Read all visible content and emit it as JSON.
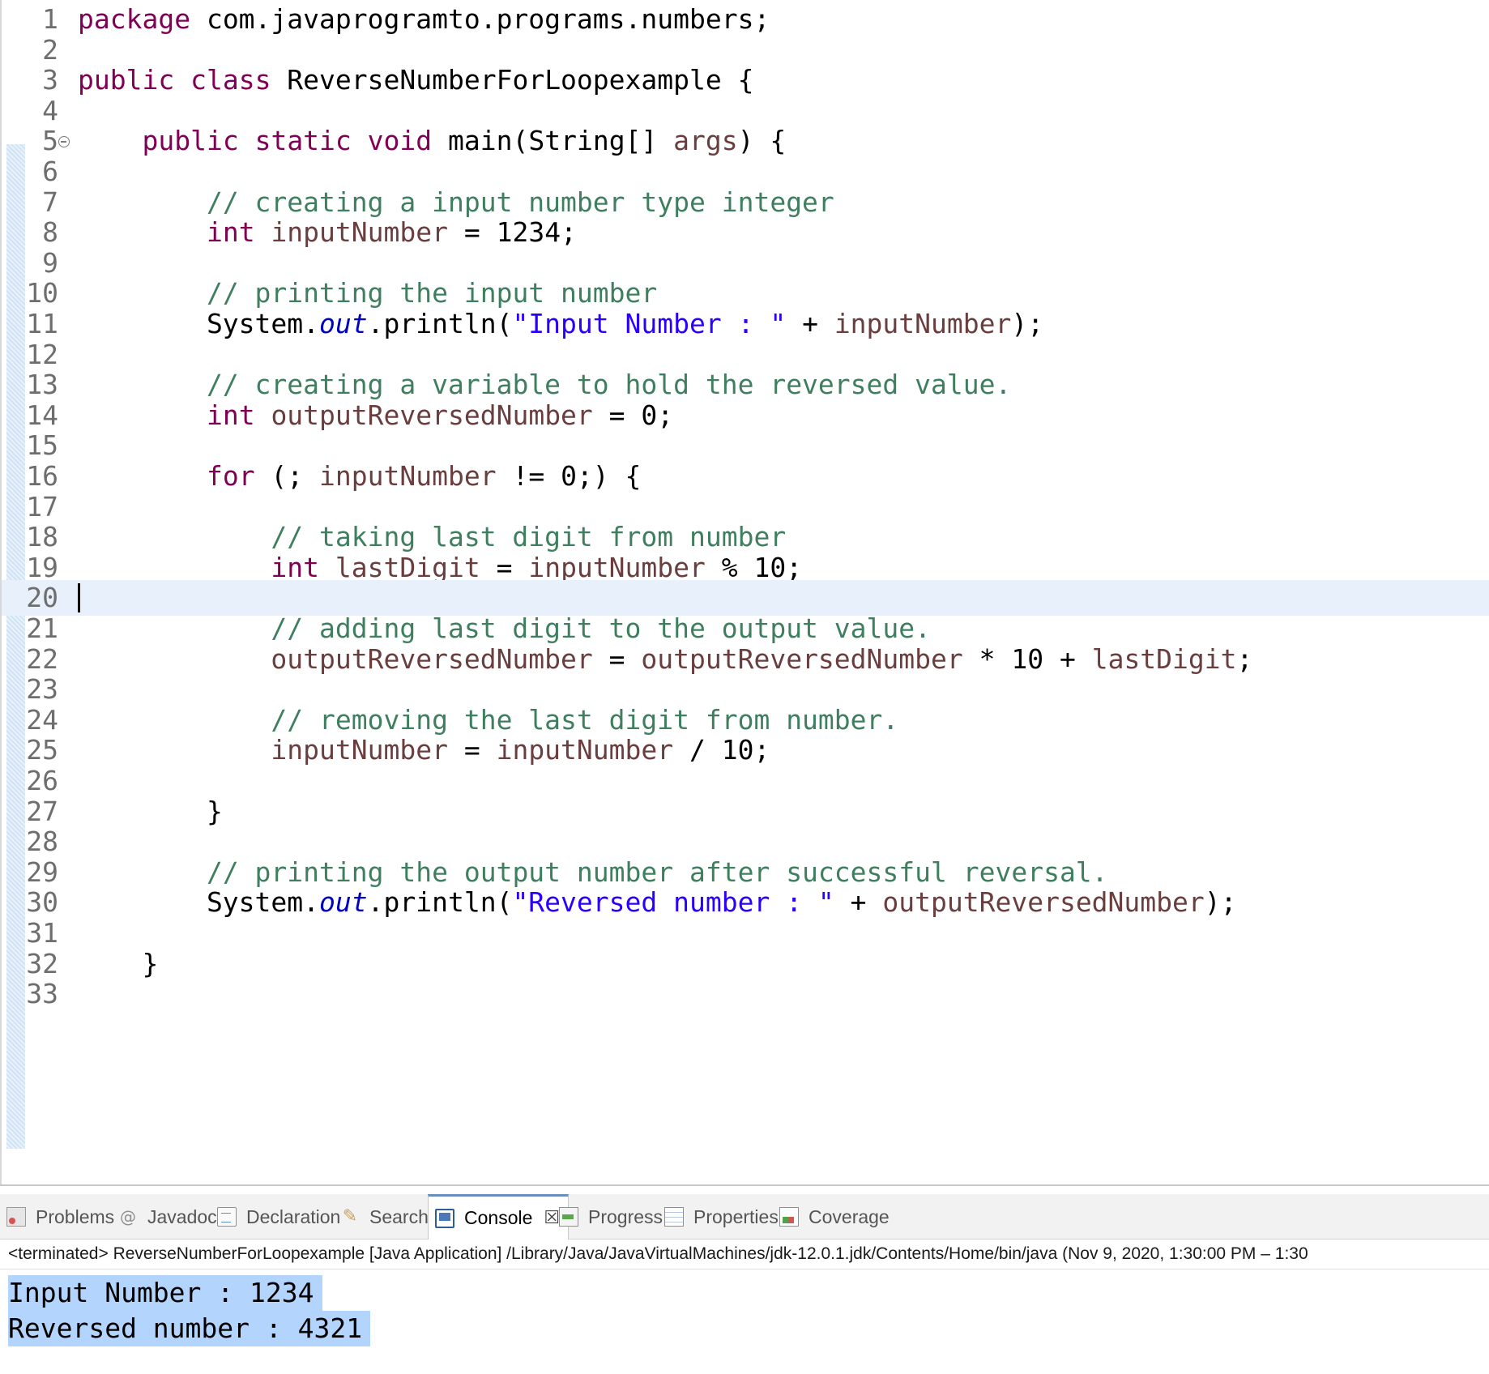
{
  "editor": {
    "current_line": 20,
    "lines": [
      {
        "n": "1",
        "tokens": [
          {
            "t": "kw",
            "s": "package"
          },
          {
            "t": "pl",
            "s": " com.javaprogramto.programs.numbers;"
          }
        ]
      },
      {
        "n": "2",
        "tokens": []
      },
      {
        "n": "3",
        "tokens": [
          {
            "t": "kw",
            "s": "public"
          },
          {
            "t": "pl",
            "s": " "
          },
          {
            "t": "kw",
            "s": "class"
          },
          {
            "t": "pl",
            "s": " ReverseNumberForLoopexample {"
          }
        ]
      },
      {
        "n": "4",
        "tokens": []
      },
      {
        "n": "5",
        "fold": true,
        "tokens": [
          {
            "t": "pl",
            "s": "    "
          },
          {
            "t": "kw",
            "s": "public"
          },
          {
            "t": "pl",
            "s": " "
          },
          {
            "t": "kw",
            "s": "static"
          },
          {
            "t": "pl",
            "s": " "
          },
          {
            "t": "kw",
            "s": "void"
          },
          {
            "t": "pl",
            "s": " main(String[] "
          },
          {
            "t": "var",
            "s": "args"
          },
          {
            "t": "pl",
            "s": ") {"
          }
        ]
      },
      {
        "n": "6",
        "tokens": []
      },
      {
        "n": "7",
        "tokens": [
          {
            "t": "pl",
            "s": "        "
          },
          {
            "t": "cm",
            "s": "// creating a input number type integer"
          }
        ]
      },
      {
        "n": "8",
        "tokens": [
          {
            "t": "pl",
            "s": "        "
          },
          {
            "t": "kw",
            "s": "int"
          },
          {
            "t": "pl",
            "s": " "
          },
          {
            "t": "var",
            "s": "inputNumber"
          },
          {
            "t": "pl",
            "s": " = 1234;"
          }
        ]
      },
      {
        "n": "9",
        "tokens": []
      },
      {
        "n": "10",
        "tokens": [
          {
            "t": "pl",
            "s": "        "
          },
          {
            "t": "cm",
            "s": "// printing the input number"
          }
        ]
      },
      {
        "n": "11",
        "tokens": [
          {
            "t": "pl",
            "s": "        System."
          },
          {
            "t": "fld",
            "s": "out"
          },
          {
            "t": "pl",
            "s": ".println("
          },
          {
            "t": "str",
            "s": "\"Input Number : \""
          },
          {
            "t": "pl",
            "s": " + "
          },
          {
            "t": "var",
            "s": "inputNumber"
          },
          {
            "t": "pl",
            "s": ");"
          }
        ]
      },
      {
        "n": "12",
        "tokens": []
      },
      {
        "n": "13",
        "tokens": [
          {
            "t": "pl",
            "s": "        "
          },
          {
            "t": "cm",
            "s": "// creating a variable to hold the reversed value."
          }
        ]
      },
      {
        "n": "14",
        "tokens": [
          {
            "t": "pl",
            "s": "        "
          },
          {
            "t": "kw",
            "s": "int"
          },
          {
            "t": "pl",
            "s": " "
          },
          {
            "t": "var",
            "s": "outputReversedNumber"
          },
          {
            "t": "pl",
            "s": " = 0;"
          }
        ]
      },
      {
        "n": "15",
        "tokens": []
      },
      {
        "n": "16",
        "tokens": [
          {
            "t": "pl",
            "s": "        "
          },
          {
            "t": "kw",
            "s": "for"
          },
          {
            "t": "pl",
            "s": " (; "
          },
          {
            "t": "var",
            "s": "inputNumber"
          },
          {
            "t": "pl",
            "s": " != 0;) {"
          }
        ]
      },
      {
        "n": "17",
        "tokens": []
      },
      {
        "n": "18",
        "tokens": [
          {
            "t": "pl",
            "s": "            "
          },
          {
            "t": "cm",
            "s": "// taking last digit from number"
          }
        ]
      },
      {
        "n": "19",
        "tokens": [
          {
            "t": "pl",
            "s": "            "
          },
          {
            "t": "kw",
            "s": "int"
          },
          {
            "t": "pl",
            "s": " "
          },
          {
            "t": "var",
            "s": "lastDigit"
          },
          {
            "t": "pl",
            "s": " = "
          },
          {
            "t": "var",
            "s": "inputNumber"
          },
          {
            "t": "pl",
            "s": " % 10;"
          }
        ]
      },
      {
        "n": "20",
        "tokens": []
      },
      {
        "n": "21",
        "tokens": [
          {
            "t": "pl",
            "s": "            "
          },
          {
            "t": "cm",
            "s": "// adding last digit to the output value."
          }
        ]
      },
      {
        "n": "22",
        "tokens": [
          {
            "t": "pl",
            "s": "            "
          },
          {
            "t": "var",
            "s": "outputReversedNumber"
          },
          {
            "t": "pl",
            "s": " = "
          },
          {
            "t": "var",
            "s": "outputReversedNumber"
          },
          {
            "t": "pl",
            "s": " * 10 + "
          },
          {
            "t": "var",
            "s": "lastDigit"
          },
          {
            "t": "pl",
            "s": ";"
          }
        ]
      },
      {
        "n": "23",
        "tokens": []
      },
      {
        "n": "24",
        "tokens": [
          {
            "t": "pl",
            "s": "            "
          },
          {
            "t": "cm",
            "s": "// removing the last digit from number."
          }
        ]
      },
      {
        "n": "25",
        "tokens": [
          {
            "t": "pl",
            "s": "            "
          },
          {
            "t": "var",
            "s": "inputNumber"
          },
          {
            "t": "pl",
            "s": " = "
          },
          {
            "t": "var",
            "s": "inputNumber"
          },
          {
            "t": "pl",
            "s": " / 10;"
          }
        ]
      },
      {
        "n": "26",
        "tokens": []
      },
      {
        "n": "27",
        "tokens": [
          {
            "t": "pl",
            "s": "        }"
          }
        ]
      },
      {
        "n": "28",
        "tokens": []
      },
      {
        "n": "29",
        "tokens": [
          {
            "t": "pl",
            "s": "        "
          },
          {
            "t": "cm",
            "s": "// printing the output number after successful reversal."
          }
        ]
      },
      {
        "n": "30",
        "tokens": [
          {
            "t": "pl",
            "s": "        System."
          },
          {
            "t": "fld",
            "s": "out"
          },
          {
            "t": "pl",
            "s": ".println("
          },
          {
            "t": "str",
            "s": "\"Reversed number : \""
          },
          {
            "t": "pl",
            "s": " + "
          },
          {
            "t": "var",
            "s": "outputReversedNumber"
          },
          {
            "t": "pl",
            "s": ");"
          }
        ]
      },
      {
        "n": "31",
        "tokens": []
      },
      {
        "n": "32",
        "tokens": [
          {
            "t": "pl",
            "s": "    }"
          }
        ]
      },
      {
        "n": "33",
        "tokens": []
      }
    ]
  },
  "views": {
    "tabs": [
      {
        "label": "Problems",
        "icon": "problems-icon"
      },
      {
        "label": "Javadoc",
        "icon": "at-icon"
      },
      {
        "label": "Declaration",
        "icon": "declaration-icon"
      },
      {
        "label": "Search",
        "icon": "search-icon"
      },
      {
        "label": "Console",
        "icon": "console-icon",
        "active": true,
        "close": "☒"
      },
      {
        "label": "Progress",
        "icon": "progress-icon"
      },
      {
        "label": "Properties",
        "icon": "properties-icon"
      },
      {
        "label": "Coverage",
        "icon": "coverage-icon"
      }
    ]
  },
  "console": {
    "header": "<terminated> ReverseNumberForLoopexample [Java Application] /Library/Java/JavaVirtualMachines/jdk-12.0.1.jdk/Contents/Home/bin/java  (Nov 9, 2020, 1:30:00 PM – 1:30",
    "output": [
      "Input Number : 1234",
      "Reversed number : 4321"
    ]
  },
  "colors": {
    "keyword": "#7f0055",
    "comment": "#3f7f5f",
    "string": "#2a00ff",
    "field": "#0000c0",
    "variable": "#6a3e3e",
    "current_line": "#e8f0fb",
    "selection": "#b3d4fc"
  }
}
